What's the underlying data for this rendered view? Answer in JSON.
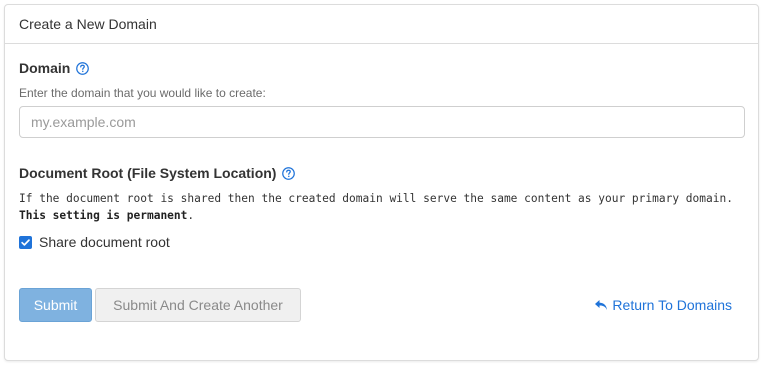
{
  "panel": {
    "title": "Create a New Domain"
  },
  "domain": {
    "label": "Domain",
    "help_text": "Enter the domain that you would like to create:",
    "value": "",
    "placeholder": "my.example.com"
  },
  "docroot": {
    "label": "Document Root (File System Location)",
    "description_plain": "If the document root is shared then the created domain will serve the same content as your primary domain.",
    "description_bold": "This setting is permanent",
    "description_end": ".",
    "checkbox_label": "Share document root",
    "checkbox_checked": true
  },
  "actions": {
    "submit_label": "Submit",
    "submit_another_label": "Submit And Create Another",
    "return_label": "Return To Domains"
  },
  "icons": {
    "help": "question-circle-icon",
    "return": "reply-arrow-icon",
    "checkbox": "checkmark-icon"
  },
  "colors": {
    "accent": "#1f73d9",
    "submit_bg": "#7fb2e0",
    "secondary_bg": "#f0f0f0"
  }
}
